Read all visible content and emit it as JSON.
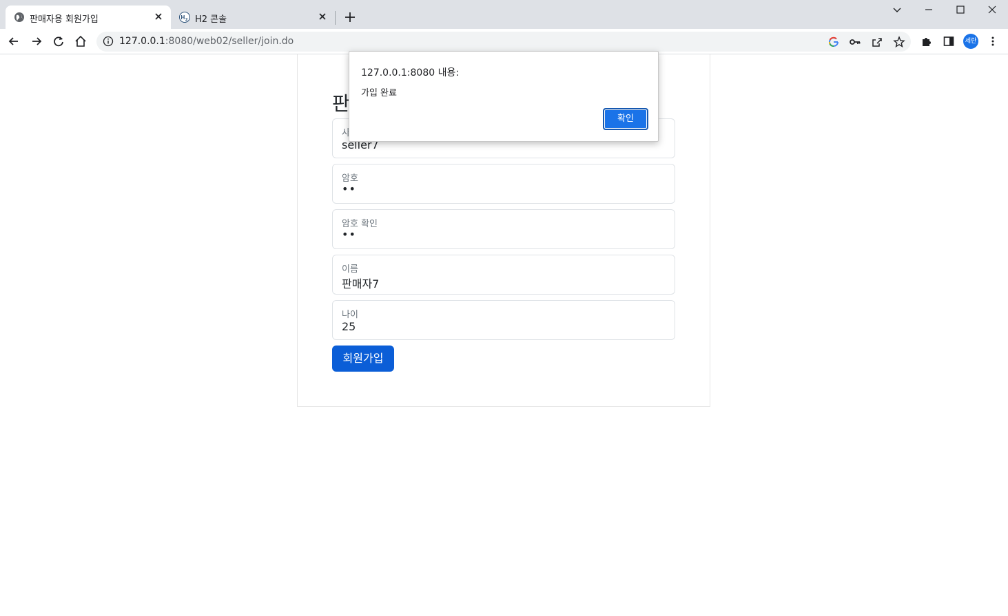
{
  "browser": {
    "tabs": [
      {
        "title": "판매자용 회원가입",
        "active": true
      },
      {
        "title": "H2 콘솔",
        "active": false
      }
    ],
    "url_host": "127.0.0.1",
    "url_rest": ":8080/web02/seller/join.do",
    "profile_label": "세란"
  },
  "page": {
    "heading": "판",
    "fields": [
      {
        "label": "사",
        "value": "seller7"
      },
      {
        "label": "암호",
        "value": "••"
      },
      {
        "label": "암호 확인",
        "value": "••"
      },
      {
        "label": "이름",
        "value": "판매자7"
      },
      {
        "label": "나이",
        "value": "25"
      }
    ],
    "submit_label": "회원가입"
  },
  "dialog": {
    "title": "127.0.0.1:8080 내용:",
    "message": "가입 완료",
    "ok_label": "확인"
  },
  "colors": {
    "primary": "#0b5ed7",
    "dialog_button": "#1a73e8",
    "tabstrip": "#dee1e6"
  }
}
